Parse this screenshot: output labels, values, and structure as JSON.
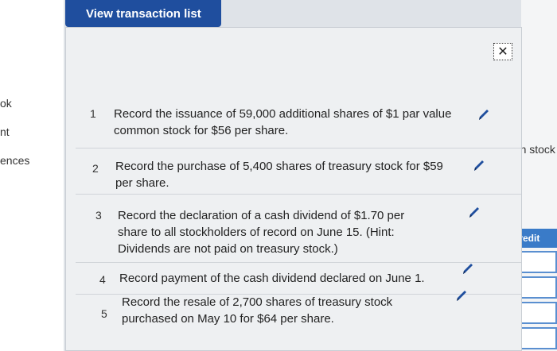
{
  "window": {
    "tab_title": "View transaction list",
    "close_glyph": "✕"
  },
  "left_panel": {
    "items": [
      "ok",
      "nt",
      "ences"
    ]
  },
  "right_panel": {
    "partial_text": "non stock",
    "credit_label": "Credit"
  },
  "transactions": [
    {
      "num": "1",
      "text": "Record the issuance of 59,000 additional shares of $1 par value common stock for $56 per share."
    },
    {
      "num": "2",
      "text": "Record the purchase of 5,400 shares of treasury stock for $59 per share."
    },
    {
      "num": "3",
      "text": "Record the declaration of a cash dividend of $1.70 per share to all stockholders of record on June 15. (Hint: Dividends are not paid on treasury stock.)"
    },
    {
      "num": "4",
      "text": "Record payment of the cash dividend declared on June 1."
    },
    {
      "num": "5",
      "text": "Record the resale of 2,700 shares of treasury stock purchased on May 10 for $64 per share."
    }
  ],
  "colors": {
    "accent": "#1f4e9e",
    "credit_header": "#3a7bc8"
  },
  "icons": {
    "edit": "pencil-icon",
    "close": "close-icon"
  }
}
